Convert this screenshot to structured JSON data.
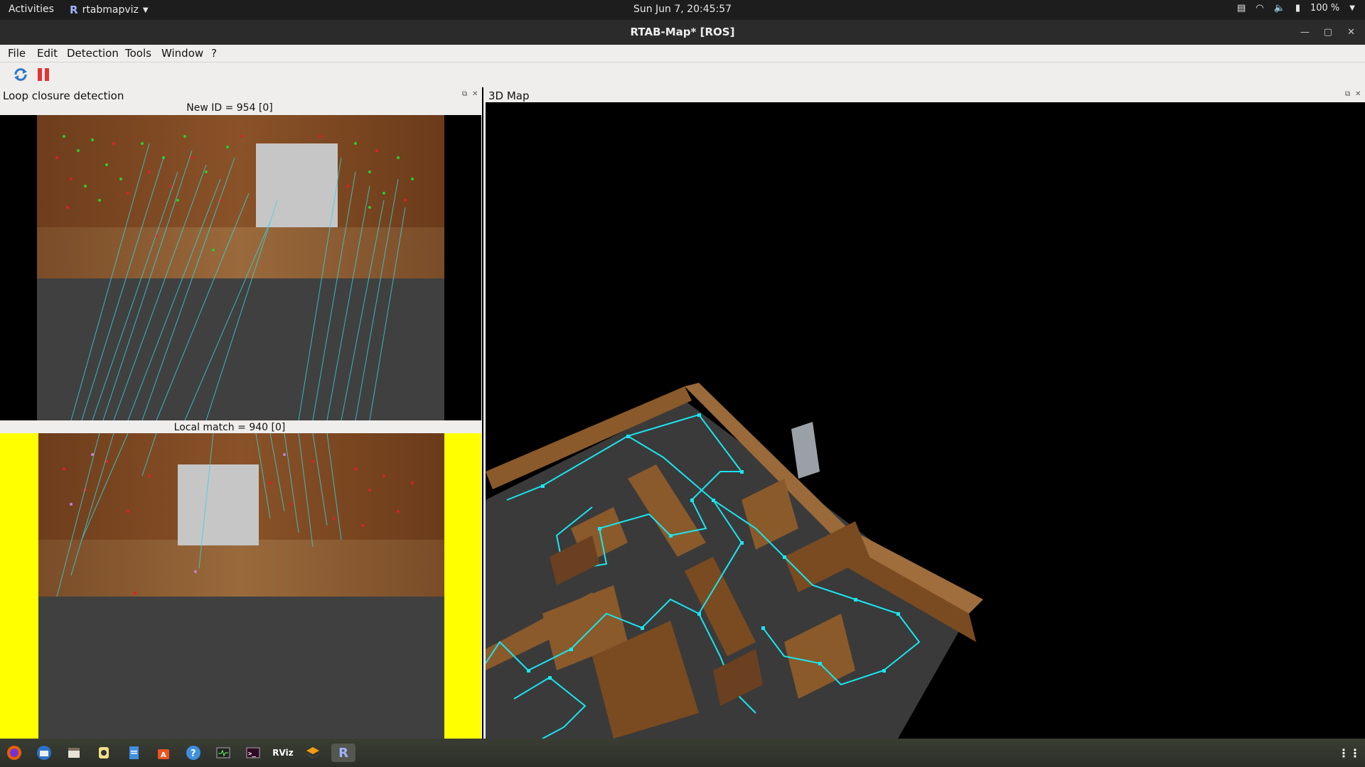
{
  "topbar": {
    "activities": "Activities",
    "app_name": "rtabmapviz",
    "clock": "Sun Jun  7, 20:45:57",
    "battery": "100 %"
  },
  "window": {
    "title": "RTAB-Map* [ROS]"
  },
  "menu": [
    "File",
    "Edit",
    "Detection",
    "Tools",
    "Window",
    "?"
  ],
  "loop_dock": {
    "title": "Loop closure detection",
    "new_id_label": "New ID = 954 [0]",
    "local_match_label": "Local match = 940 [0]"
  },
  "map_dock": {
    "title": "3D Map"
  },
  "taskbar": {
    "rviz_label": "RViz",
    "rtabmap_label": "R"
  },
  "colors": {
    "path": "#19e6f0",
    "wood": "#8a5a2b",
    "floor": "#3c3c3c",
    "yellow": "#ffff00"
  }
}
